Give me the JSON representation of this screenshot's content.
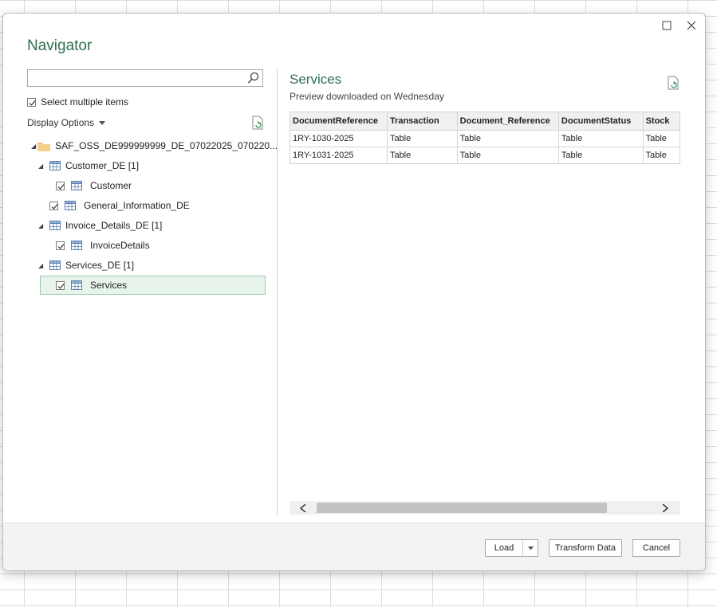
{
  "dialog": {
    "title": "Navigator",
    "search": {
      "value": "",
      "placeholder": ""
    },
    "select_multiple_label": "Select multiple items",
    "display_options_label": "Display Options",
    "tree": {
      "root": "SAF_OSS_DE999999999_DE_07022025_070220...",
      "customer_group": "Customer_DE [1]",
      "customer": "Customer",
      "general_info": "General_Information_DE",
      "invoice_group": "Invoice_Details_DE [1]",
      "invoice": "InvoiceDetails",
      "services_group": "Services_DE [1]",
      "services": "Services"
    },
    "preview": {
      "title": "Services",
      "subtitle": "Preview downloaded on Wednesday",
      "columns": [
        "DocumentReference",
        "Transaction",
        "Document_Reference",
        "DocumentStatus",
        "Stock"
      ],
      "rows": [
        [
          "1RY-1030-2025",
          "Table",
          "Table",
          "Table",
          "Table"
        ],
        [
          "1RY-1031-2025",
          "Table",
          "Table",
          "Table",
          "Table"
        ]
      ]
    },
    "buttons": {
      "load": "Load",
      "transform": "Transform Data",
      "cancel": "Cancel"
    }
  }
}
